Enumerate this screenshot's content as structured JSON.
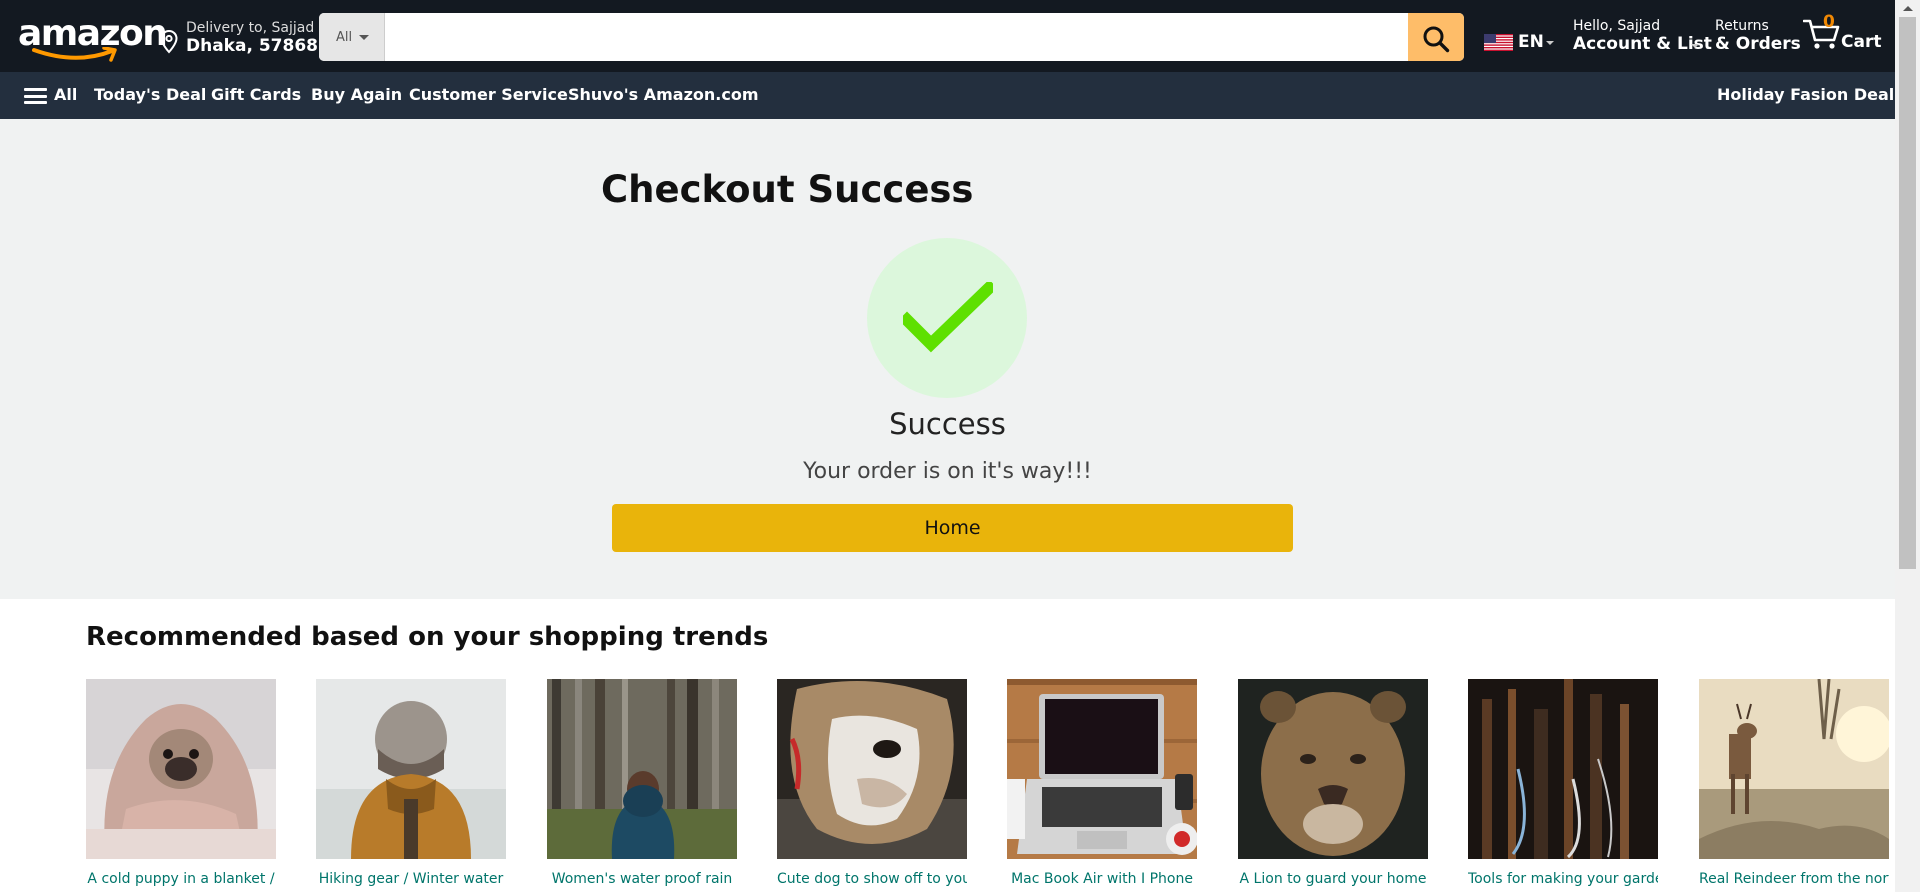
{
  "header": {
    "logo": "amazon",
    "delivery": {
      "line1": "Delivery to, Sajjad",
      "line2": "Dhaka, 57868"
    },
    "search": {
      "category": "All",
      "placeholder": "",
      "value": ""
    },
    "language": "EN",
    "account": {
      "line1": "Hello, Sajjad",
      "line2": "Account & List"
    },
    "returns": {
      "line1": "Returns",
      "line2": "& Orders"
    },
    "cart": {
      "count": "0",
      "label": "Cart"
    }
  },
  "subnav": {
    "all": "All",
    "items": [
      "Today's Deal",
      "Gift Cards",
      "Buy Again",
      "Customer Service",
      "Shuvo's Amazon.com"
    ],
    "right": "Holiday Fasion Deals"
  },
  "checkout": {
    "title": "Checkout Success",
    "heading": "Success",
    "message": "Your order is on it's way!!!",
    "home_button": "Home"
  },
  "recommended": {
    "title": "Recommended based on your shopping trends",
    "items": [
      {
        "caption": "A cold puppy in a blanket /",
        "image": "pug-in-blanket"
      },
      {
        "caption": "Hiking gear / Winter water",
        "image": "person-in-beanie"
      },
      {
        "caption": "Women's water proof rain",
        "image": "woman-in-forest"
      },
      {
        "caption": "Cute dog to show off to your",
        "image": "bulldog"
      },
      {
        "caption": "Mac Book Air with I Phone",
        "image": "laptop-on-desk"
      },
      {
        "caption": "A Lion to guard your home",
        "image": "lioness"
      },
      {
        "caption": "Tools for making your garden",
        "image": "garden-tools"
      },
      {
        "caption": "Real Reindeer from the north",
        "image": "deer-in-field"
      }
    ]
  },
  "colors": {
    "nav_dark": "#131921",
    "nav_sub": "#232f3e",
    "search_button": "#febd69",
    "home_button": "#e9b40b",
    "success_check": "#5ee000",
    "success_circle": "#dcf7dc",
    "caption_link": "#00756b"
  }
}
